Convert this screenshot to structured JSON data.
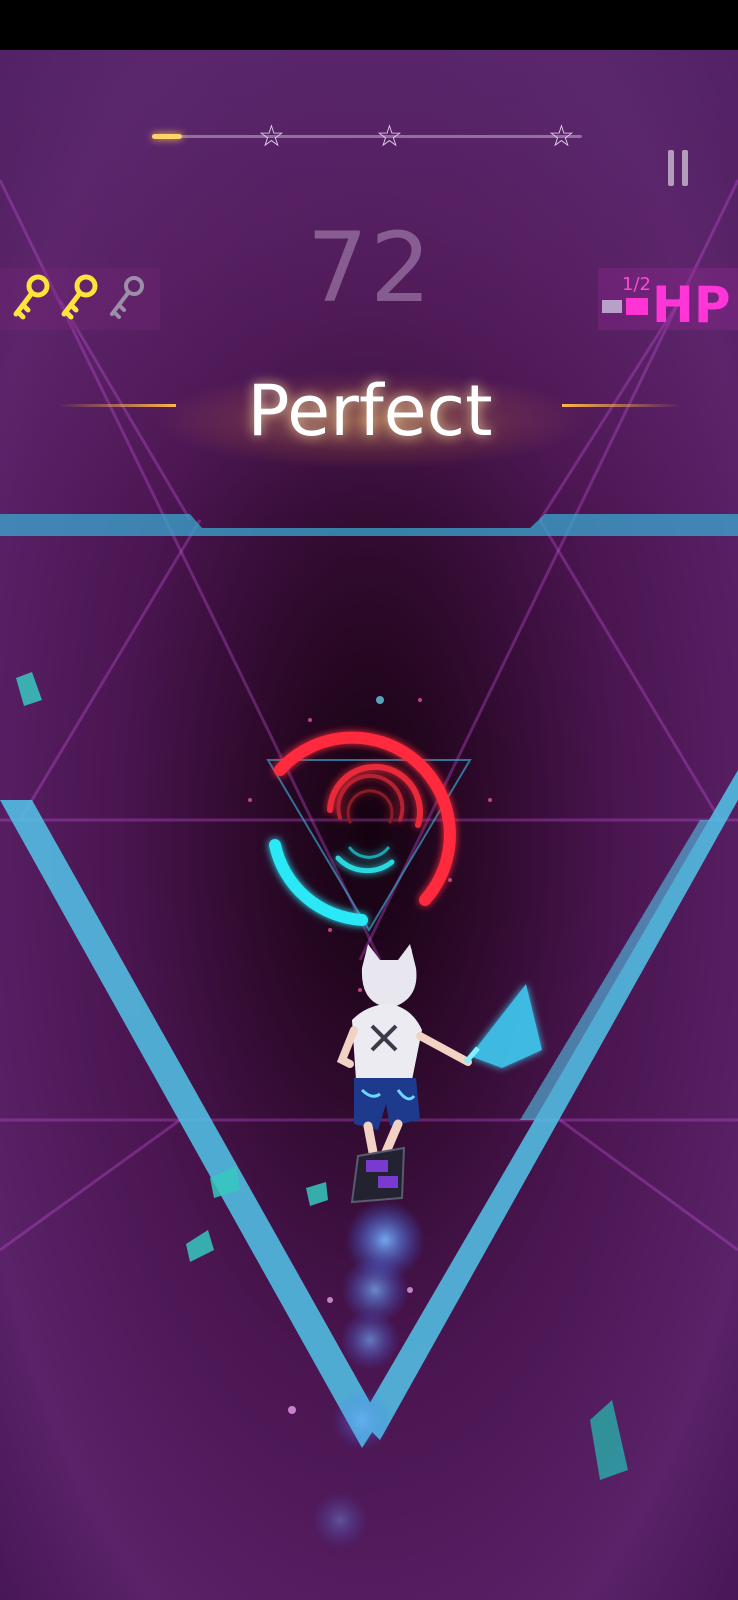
{
  "hud": {
    "score": "72",
    "rating": "Perfect",
    "progress_fraction": 0.07,
    "stars_total": 3,
    "stars_earned": 0,
    "keys_collected": 2,
    "keys_total": 3,
    "hp_fraction_label": "1/2",
    "hp_label": "HP"
  },
  "icons": {
    "star": "star-outline-icon",
    "key": "key-icon",
    "pause": "pause-icon"
  },
  "colors": {
    "hp": "#ff35d8",
    "key_collected": "#ffe23a",
    "key_empty": "#9a8ea8",
    "ring_red": "#ff2a3c",
    "ring_cyan": "#29e8f5",
    "tunnel_edge": "#4dc6e6",
    "background": "#3a0f4c"
  }
}
